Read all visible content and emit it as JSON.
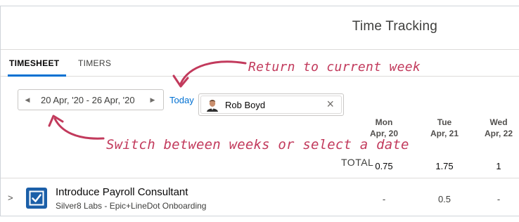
{
  "header": {
    "title": "Time Tracking"
  },
  "tabs": [
    {
      "label": "TIMESHEET",
      "active": true
    },
    {
      "label": "TIMERS",
      "active": false
    }
  ],
  "annotations": {
    "return_to_current_week": "Return to current week",
    "switch_weeks": "Switch between weeks or select a date"
  },
  "controls": {
    "date_range": "20 Apr, '20 - 26 Apr, '20",
    "today_label": "Today",
    "user_name": "Rob Boyd",
    "prev_icon": "triangle-left-icon",
    "next_icon": "triangle-right-icon"
  },
  "days": [
    {
      "name": "Mon",
      "date": "Apr, 20",
      "total": "0.75"
    },
    {
      "name": "Tue",
      "date": "Apr, 21",
      "total": "1.75"
    },
    {
      "name": "Wed",
      "date": "Apr, 22",
      "total": "1"
    }
  ],
  "total_label": "TOTAL",
  "rows": [
    {
      "task": "Introduce Payroll Consultant",
      "project": "Silver8 Labs - Epic+LineDot Onboarding",
      "values": [
        "-",
        "0.5",
        "-"
      ]
    }
  ],
  "colors": {
    "accent": "#0070d2",
    "annotation": "#c23a5c",
    "task_icon": "#1b5fa8"
  }
}
